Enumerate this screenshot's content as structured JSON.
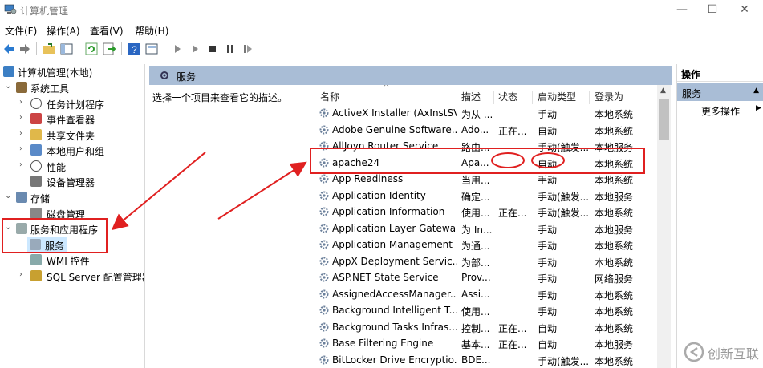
{
  "window": {
    "title": "计算机管理",
    "min": "—",
    "max": "☐",
    "close": "✕"
  },
  "menu": [
    "文件(F)",
    "操作(A)",
    "查看(V)",
    "帮助(H)"
  ],
  "toolbar_icons": [
    "back-icon",
    "forward-icon",
    "up-folder-icon",
    "show-hide-tree-icon",
    "refresh-icon",
    "export-icon",
    "help-icon",
    "properties-icon",
    "start-icon",
    "start-alt-icon",
    "stop-icon",
    "pause-icon",
    "resume-icon"
  ],
  "tree": {
    "root": "计算机管理(本地)",
    "system_tools": "系统工具",
    "task_scheduler": "任务计划程序",
    "event_viewer": "事件查看器",
    "shared_folders": "共享文件夹",
    "local_users": "本地用户和组",
    "performance": "性能",
    "device_manager": "设备管理器",
    "storage": "存储",
    "disk_management": "磁盘管理",
    "services_apps": "服务和应用程序",
    "services": "服务",
    "wmi": "WMI 控件",
    "sql_server": "SQL Server 配置管理器"
  },
  "panel": {
    "title": "服务",
    "hint": "选择一个项目来查看它的描述。"
  },
  "columns": {
    "name": "名称",
    "desc": "描述",
    "status": "状态",
    "startup": "启动类型",
    "logon": "登录为"
  },
  "services": [
    {
      "name": "ActiveX Installer (AxInstSV)",
      "desc": "为从 ...",
      "status": "",
      "startup": "手动",
      "logon": "本地系统"
    },
    {
      "name": "Adobe Genuine Software...",
      "desc": "Ado...",
      "status": "正在...",
      "startup": "自动",
      "logon": "本地系统"
    },
    {
      "name": "AllJoyn Router Service",
      "desc": "路由...",
      "status": "",
      "startup": "手动(触发...",
      "logon": "本地服务"
    },
    {
      "name": "apache24",
      "desc": "Apa...",
      "status": "",
      "startup": "自动",
      "logon": "本地系统"
    },
    {
      "name": "App Readiness",
      "desc": "当用...",
      "status": "",
      "startup": "手动",
      "logon": "本地系统"
    },
    {
      "name": "Application Identity",
      "desc": "确定...",
      "status": "",
      "startup": "手动(触发...",
      "logon": "本地服务"
    },
    {
      "name": "Application Information",
      "desc": "使用...",
      "status": "正在...",
      "startup": "手动(触发...",
      "logon": "本地系统"
    },
    {
      "name": "Application Layer Gatewa...",
      "desc": "为 In...",
      "status": "",
      "startup": "手动",
      "logon": "本地服务"
    },
    {
      "name": "Application Management",
      "desc": "为通...",
      "status": "",
      "startup": "手动",
      "logon": "本地系统"
    },
    {
      "name": "AppX Deployment Servic...",
      "desc": "为部...",
      "status": "",
      "startup": "手动",
      "logon": "本地系统"
    },
    {
      "name": "ASP.NET State Service",
      "desc": "Prov...",
      "status": "",
      "startup": "手动",
      "logon": "网络服务"
    },
    {
      "name": "AssignedAccessManager...",
      "desc": "Assi...",
      "status": "",
      "startup": "手动",
      "logon": "本地系统"
    },
    {
      "name": "Background Intelligent T...",
      "desc": "使用...",
      "status": "",
      "startup": "手动",
      "logon": "本地系统"
    },
    {
      "name": "Background Tasks Infras...",
      "desc": "控制...",
      "status": "正在...",
      "startup": "自动",
      "logon": "本地系统"
    },
    {
      "name": "Base Filtering Engine",
      "desc": "基本...",
      "status": "正在...",
      "startup": "自动",
      "logon": "本地服务"
    },
    {
      "name": "BitLocker Drive Encryptio...",
      "desc": "BDE...",
      "status": "",
      "startup": "手动(触发...",
      "logon": "本地系统"
    }
  ],
  "actions": {
    "title": "操作",
    "section": "服务",
    "more": "更多操作"
  },
  "watermark": "创新互联",
  "colors": {
    "accent": "#a9bdd6",
    "annotation": "#e02020",
    "selection": "#cce8ff"
  }
}
